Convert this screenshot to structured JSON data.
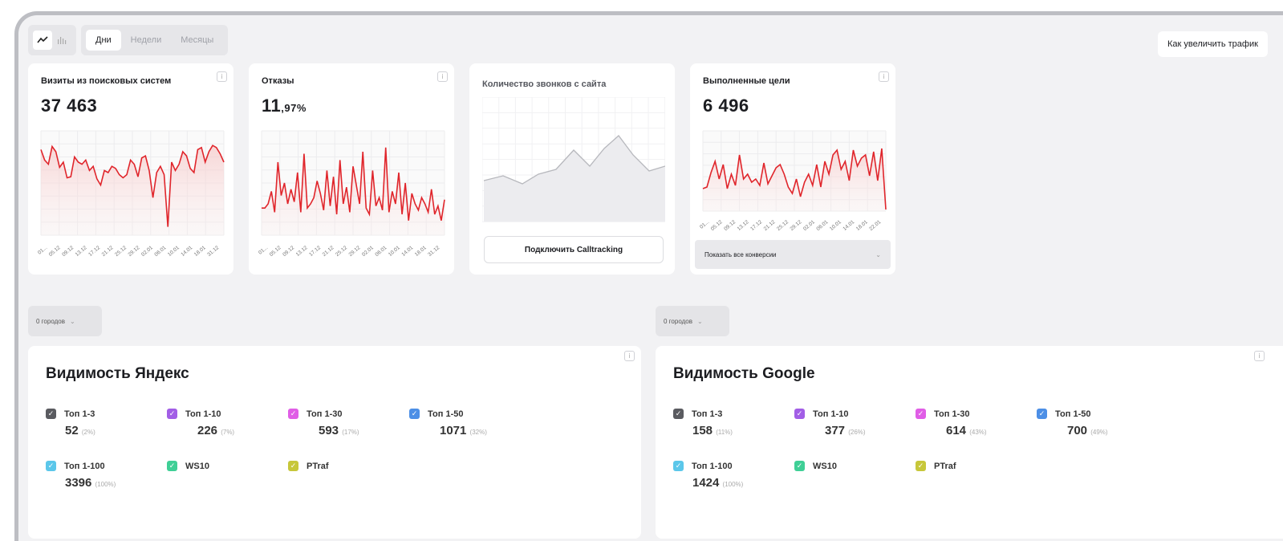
{
  "toolbar": {
    "icons": [
      "line-chart-icon",
      "bar-chart-icon"
    ],
    "tabs": [
      {
        "label": "Дни",
        "active": true
      },
      {
        "label": "Недели",
        "active": false
      },
      {
        "label": "Месяцы",
        "active": false
      }
    ],
    "help_button": "Как увеличить трафик"
  },
  "cards": {
    "visits": {
      "title": "Визиты из поисковых систем",
      "value": "37 463",
      "x_labels": [
        "01...",
        "05.12",
        "09.12",
        "13.12",
        "17.12",
        "21.12",
        "25.12",
        "29.12",
        "02.01",
        "06.01",
        "10.01",
        "14.01",
        "18.01",
        "31.12"
      ]
    },
    "bounces": {
      "title": "Отказы",
      "value_int": "11",
      "value_frac": ",97%",
      "x_labels": [
        "01...",
        "05.12",
        "09.12",
        "13.12",
        "17.12",
        "21.12",
        "25.12",
        "29.12",
        "02.01",
        "06.01",
        "10.01",
        "14.01",
        "18.01",
        "31.12"
      ]
    },
    "calls": {
      "title": "Количество звонков с сайта",
      "button": "Подключить Calltracking"
    },
    "goals": {
      "title": "Выполненные цели",
      "value": "6 496",
      "x_labels": [
        "01...",
        "05.12",
        "09.12",
        "13.12",
        "17.12",
        "21.12",
        "25.12",
        "29.12",
        "02.01",
        "06.01",
        "10.01",
        "14.01",
        "18.01",
        "22.01"
      ],
      "conversions_label": "Показать все конверсии"
    }
  },
  "cities": {
    "left": "0 городов",
    "right": "0 городов"
  },
  "visibility": {
    "yandex": {
      "title": "Видимость Яндекс",
      "metrics": [
        {
          "label": "Топ 1-3",
          "value": "52",
          "pct": "(2%)",
          "color": "#5a5b60"
        },
        {
          "label": "Топ 1-10",
          "value": "226",
          "pct": "(7%)",
          "color": "#a25ee6"
        },
        {
          "label": "Топ 1-30",
          "value": "593",
          "pct": "(17%)",
          "color": "#e05ee6"
        },
        {
          "label": "Топ 1-50",
          "value": "1071",
          "pct": "(32%)",
          "color": "#4c8fe6"
        },
        {
          "label": "Топ 1-100",
          "value": "3396",
          "pct": "(100%)",
          "color": "#5bc7ea"
        },
        {
          "label": "WS10",
          "value": "",
          "pct": "",
          "color": "#3fcf96"
        },
        {
          "label": "PTraf",
          "value": "",
          "pct": "",
          "color": "#c7c73a"
        }
      ]
    },
    "google": {
      "title": "Видимость Google",
      "metrics": [
        {
          "label": "Топ 1-3",
          "value": "158",
          "pct": "(11%)",
          "color": "#5a5b60"
        },
        {
          "label": "Топ 1-10",
          "value": "377",
          "pct": "(26%)",
          "color": "#a25ee6"
        },
        {
          "label": "Топ 1-30",
          "value": "614",
          "pct": "(43%)",
          "color": "#e05ee6"
        },
        {
          "label": "Топ 1-50",
          "value": "700",
          "pct": "(49%)",
          "color": "#4c8fe6"
        },
        {
          "label": "Топ 1-100",
          "value": "1424",
          "pct": "(100%)",
          "color": "#5bc7ea"
        },
        {
          "label": "WS10",
          "value": "",
          "pct": "",
          "color": "#3fcf96"
        },
        {
          "label": "PTraf",
          "value": "",
          "pct": "",
          "color": "#c7c73a"
        }
      ]
    }
  }
}
